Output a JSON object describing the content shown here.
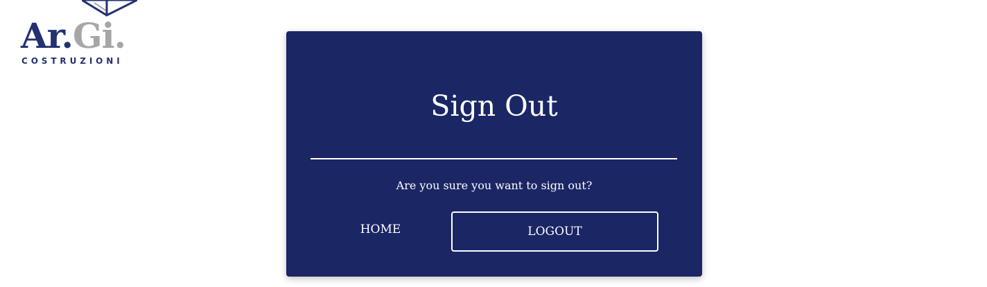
{
  "logo": {
    "word_part1": "Ar.",
    "word_part2": "Gi.",
    "subtitle": "COSTRUZIONI",
    "colors": {
      "primary": "#233172",
      "secondary": "#a6a6a8"
    }
  },
  "signout_card": {
    "title": "Sign Out",
    "message": "Are you sure you want to sign out?",
    "home_label": "HOME",
    "logout_label": "LOGOUT",
    "background_color": "#1b2665",
    "text_color": "#ffffff"
  }
}
